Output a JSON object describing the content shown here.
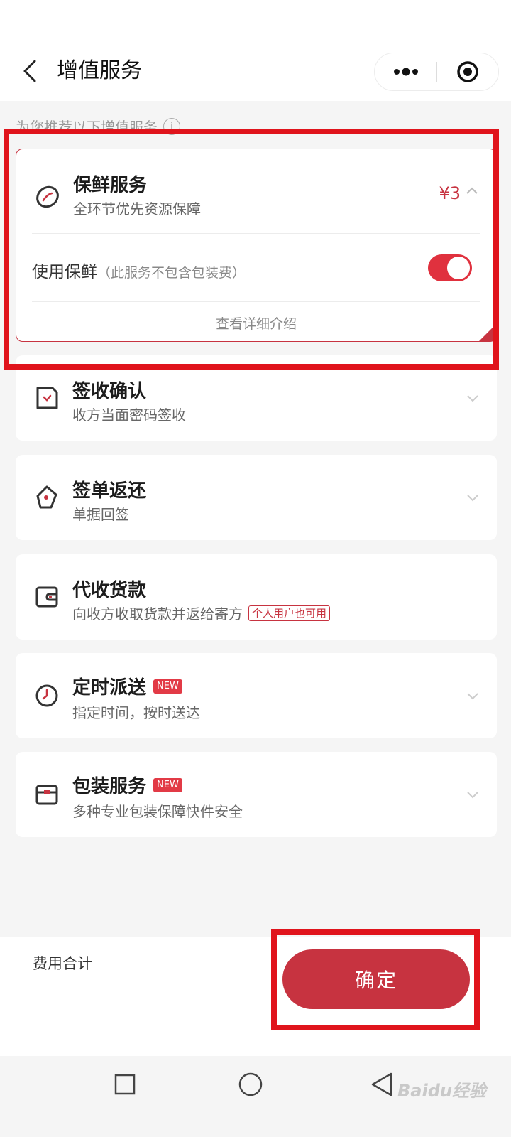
{
  "header": {
    "title": "增值服务",
    "back_icon": "chevron-left-icon",
    "more_icon": "more-dots-icon",
    "close_icon": "target-circle-icon"
  },
  "section_hint": "为您推荐以下增值服务",
  "services": [
    {
      "id": "fresh",
      "icon": "lemon-icon",
      "title": "保鲜服务",
      "subtitle": "全环节优先资源保障",
      "price": "¥3",
      "expanded": true,
      "use_label": "使用保鲜",
      "use_note": "（此服务不包含包装费）",
      "toggle_on": true,
      "detail_link": "查看详细介绍"
    },
    {
      "id": "sign-confirm",
      "icon": "signed-document-icon",
      "title": "签收确认",
      "subtitle": "收方当面密码签收"
    },
    {
      "id": "sign-return",
      "icon": "pen-nib-icon",
      "title": "签单返还",
      "subtitle": "单据回签"
    },
    {
      "id": "cod",
      "icon": "wallet-icon",
      "title": "代收货款",
      "subtitle": "向收方收取货款并返给寄方",
      "tag": "个人用户也可用"
    },
    {
      "id": "timed",
      "icon": "clock-icon",
      "title": "定时派送",
      "badge": "NEW",
      "subtitle": "指定时间，按时送达"
    },
    {
      "id": "packaging",
      "icon": "box-icon",
      "title": "包装服务",
      "badge": "NEW",
      "subtitle": "多种专业包装保障快件安全"
    }
  ],
  "footer": {
    "total_label": "费用合计",
    "confirm_label": "确定"
  },
  "system_nav": {
    "recent_icon": "square-icon",
    "home_icon": "circle-icon",
    "back_icon": "triangle-back-icon"
  },
  "watermark": "Baidu经验",
  "colors": {
    "accent": "#c73340",
    "highlight_frame": "#e0141c",
    "toggle_on": "#e0313e"
  }
}
